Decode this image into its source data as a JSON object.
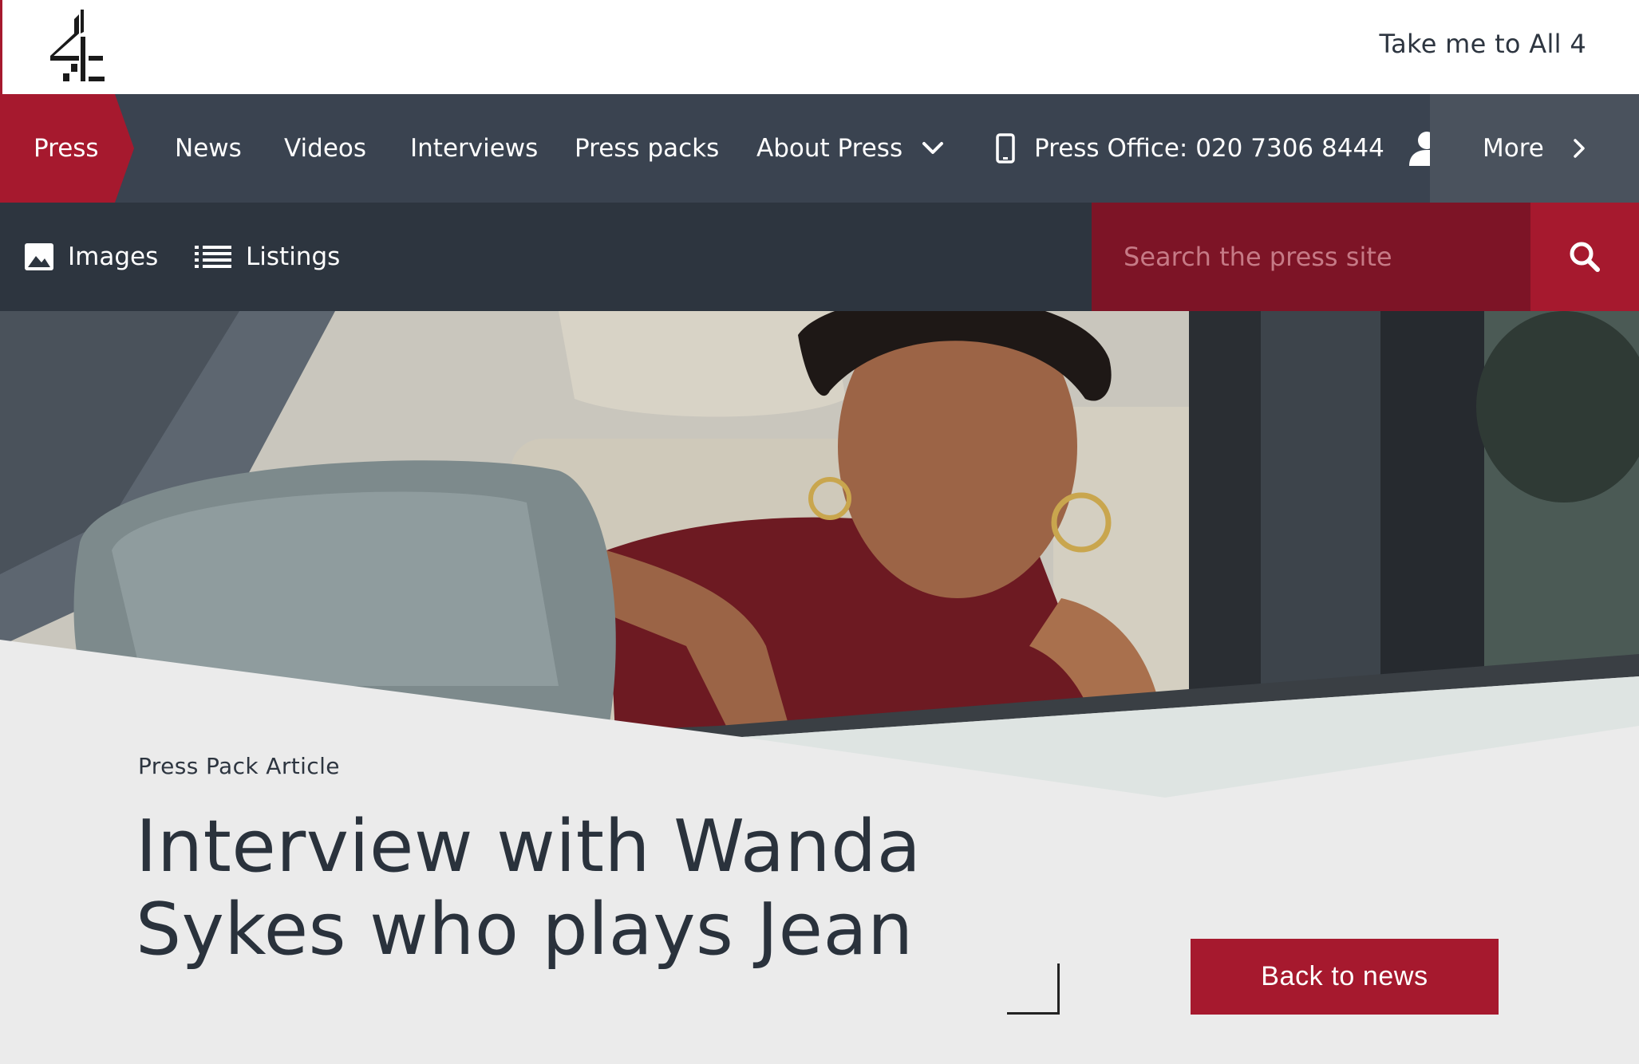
{
  "header": {
    "logo_name": "channel-4-logo",
    "all4_link": "Take me to All 4"
  },
  "primary_nav": {
    "active": "Press",
    "items": [
      "News",
      "Videos",
      "Interviews",
      "Press packs",
      "About Press"
    ],
    "press_office": "Press Office: 020 7306 8444",
    "more": "More"
  },
  "secondary_nav": {
    "images": "Images",
    "listings": "Listings",
    "search_placeholder": "Search the press site"
  },
  "article": {
    "type": "Press Pack Article",
    "title": "Interview with Wanda Sykes who plays Jean",
    "back_button": "Back to news"
  },
  "colors": {
    "brand_red": "#a6192e",
    "dark_red": "#7d1426",
    "nav_dark": "#3a4350",
    "subnav_dark": "#2d353f",
    "page_bg": "#ebebeb"
  }
}
